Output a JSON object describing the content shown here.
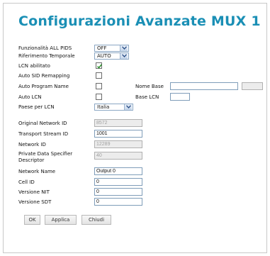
{
  "title": "Configurazioni Avanzate MUX 1",
  "labels": {
    "funz_all_pids": "Funzionalità ALL PIDS",
    "rif_temporale": "Riferimento Temporale",
    "lcn_abilitato": "LCN abilitato",
    "auto_sid": "Auto SID Remapping",
    "auto_program": "Auto Program Name",
    "auto_lcn": "Auto LCN",
    "paese_lcn": "Paese per LCN",
    "nome_base": "Nome Base",
    "base_lcn": "Base LCN",
    "original_network_id": "Original Network ID",
    "transport_stream_id": "Transport Stream ID",
    "network_id": "Network ID",
    "private_data": "Private Data Specifier Descriptor",
    "network_name": "Network Name",
    "cell_id": "Cell ID",
    "versione_nit": "Versione NIT",
    "versione_sdt": "Versione SDT"
  },
  "selects": {
    "funz_all_pids": "OFF",
    "rif_temporale": "AUTO",
    "paese_lcn": "Italia"
  },
  "checkboxes": {
    "lcn_abilitato": true,
    "auto_sid": false,
    "auto_program": false,
    "auto_lcn": false
  },
  "values": {
    "original_network_id": "8572",
    "transport_stream_id": "1001",
    "network_id": "12289",
    "private_data": "40",
    "network_name": "Output 0",
    "cell_id": "0",
    "versione_nit": "0",
    "versione_sdt": "0",
    "nome_base": "",
    "nome_base_extra": "",
    "base_lcn": ""
  },
  "buttons": {
    "ok": "OK",
    "applica": "Applica",
    "chiudi": "Chiudi"
  },
  "colors": {
    "title": "#1a8fb5"
  }
}
